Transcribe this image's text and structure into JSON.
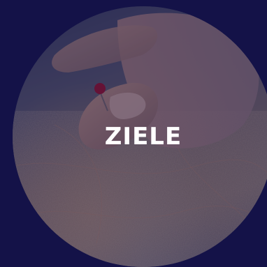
{
  "tile": {
    "label": "ZIELE"
  },
  "colors": {
    "background": "#141248",
    "label": "#ffffff",
    "pin": "#a0122a"
  },
  "image": {
    "subject": "finger-placing-pin-on-map"
  }
}
